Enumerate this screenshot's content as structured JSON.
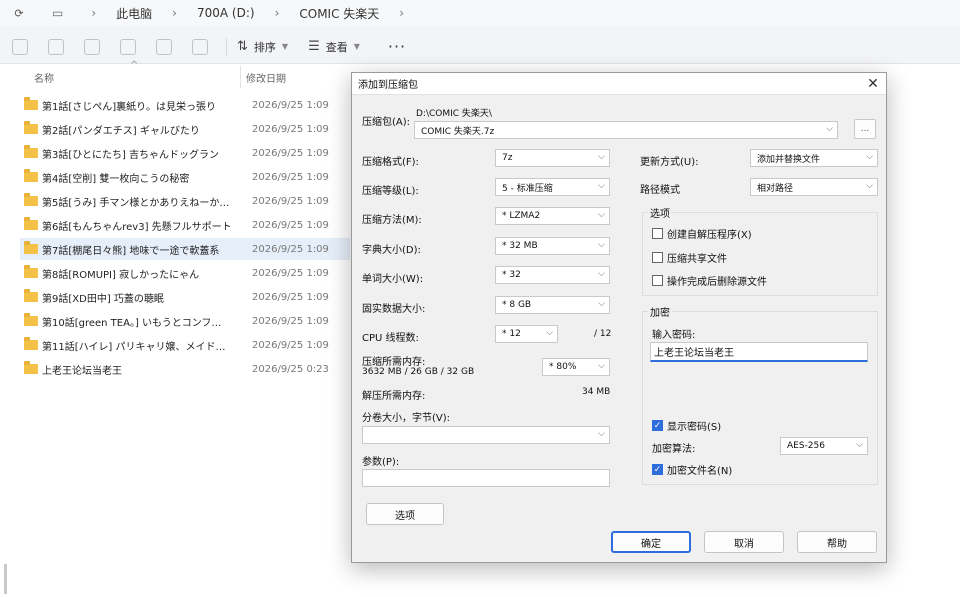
{
  "explorer": {
    "breadcrumbs": [
      "此电脑",
      "700A (D:)",
      "COMIC 失楽天"
    ],
    "toolbar": {
      "sort_label": "排序",
      "view_label": "查看",
      "more_label": "···"
    },
    "columns": {
      "name": "名称",
      "modified": "修改日期"
    },
    "files": [
      {
        "name": "第1話[さじぺん]裏紙り。は見栄っ張り",
        "date": "2026/9/25 1:09"
      },
      {
        "name": "第2話[パンダエチス] ギャルびたり",
        "date": "2026/9/25 1:09"
      },
      {
        "name": "第3話[ひとにたち] 吉ちゃんドッグラン",
        "date": "2026/9/25 1:09"
      },
      {
        "name": "第4話[空削] 雙一枚向こうの秘密",
        "date": "2026/9/25 1:09"
      },
      {
        "name": "第5話[うみ] 手マン様とかありえねーか…",
        "date": "2026/9/25 1:09"
      },
      {
        "name": "第6話[もんちゃんrev3] 先懸フルサポート",
        "date": "2026/9/25 1:09"
      },
      {
        "name": "第7話[棚尾日々熊] 地味で一途で軟蓋系",
        "date": "2026/9/25 1:09"
      },
      {
        "name": "第8話[ROMUPI] 寂しかったにゃん",
        "date": "2026/9/25 1:09"
      },
      {
        "name": "第9話[XD田中] 巧蓋の聴眠",
        "date": "2026/9/25 1:09"
      },
      {
        "name": "第10話[green TEA。] いもうとコンフ…",
        "date": "2026/9/25 1:09"
      },
      {
        "name": "第11話[ハイレ] パリキャリ嬢、メイド…",
        "date": "2026/9/25 1:09"
      },
      {
        "name": "上老王论坛当老王",
        "date": "2026/9/25 0:23"
      }
    ]
  },
  "dialog": {
    "title": "添加到压缩包",
    "close_label": "✕",
    "archive": {
      "label": "压缩包(A):",
      "path": "D:\\COMIC 失楽天\\",
      "filename": "COMIC 失楽天.7z",
      "browse_label": "..."
    },
    "format": {
      "label": "压缩格式(F):",
      "value": "7z"
    },
    "level": {
      "label": "压缩等级(L):",
      "value": "5 - 标准压缩"
    },
    "method": {
      "label": "压缩方法(M):",
      "value": "* LZMA2"
    },
    "dict": {
      "label": "字典大小(D):",
      "value": "* 32 MB"
    },
    "word": {
      "label": "单词大小(W):",
      "value": "* 32"
    },
    "solid": {
      "label": "固实数据大小:",
      "value": "* 8 GB"
    },
    "cpu": {
      "label": "CPU 线程数:",
      "value": "* 12",
      "total": "/ 12"
    },
    "mem_compress": {
      "label": "压缩所需内存:",
      "detail": "3632 MB / 26 GB / 32 GB",
      "value": "* 80%"
    },
    "mem_decompress": {
      "label": "解压所需内存:",
      "value": "34 MB"
    },
    "split": {
      "label": "分卷大小，字节(V):",
      "value": ""
    },
    "params": {
      "label": "参数(P):",
      "value": ""
    },
    "options_button": "选项",
    "update": {
      "label": "更新方式(U):",
      "value": "添加并替换文件"
    },
    "pathmode": {
      "label": "路径模式",
      "value": "相对路径"
    },
    "options_group": {
      "title": "选项",
      "items": [
        {
          "label": "创建自解压程序(X)",
          "checked": false
        },
        {
          "label": "压缩共享文件",
          "checked": false
        },
        {
          "label": "操作完成后删除源文件",
          "checked": false
        }
      ]
    },
    "encryption": {
      "title": "加密",
      "password_label": "输入密码:",
      "password_value": "上老王论坛当老王",
      "show_password": {
        "label": "显示密码(S)",
        "checked": true
      },
      "method_label": "加密算法:",
      "method_value": "AES-256",
      "encrypt_names": {
        "label": "加密文件名(N)",
        "checked": true
      }
    },
    "buttons": {
      "ok": "确定",
      "cancel": "取消",
      "help": "帮助"
    }
  },
  "colors": {
    "accent": "#2d6ddc",
    "folder": "#f4c148",
    "selected_row": "#e6eef9"
  }
}
